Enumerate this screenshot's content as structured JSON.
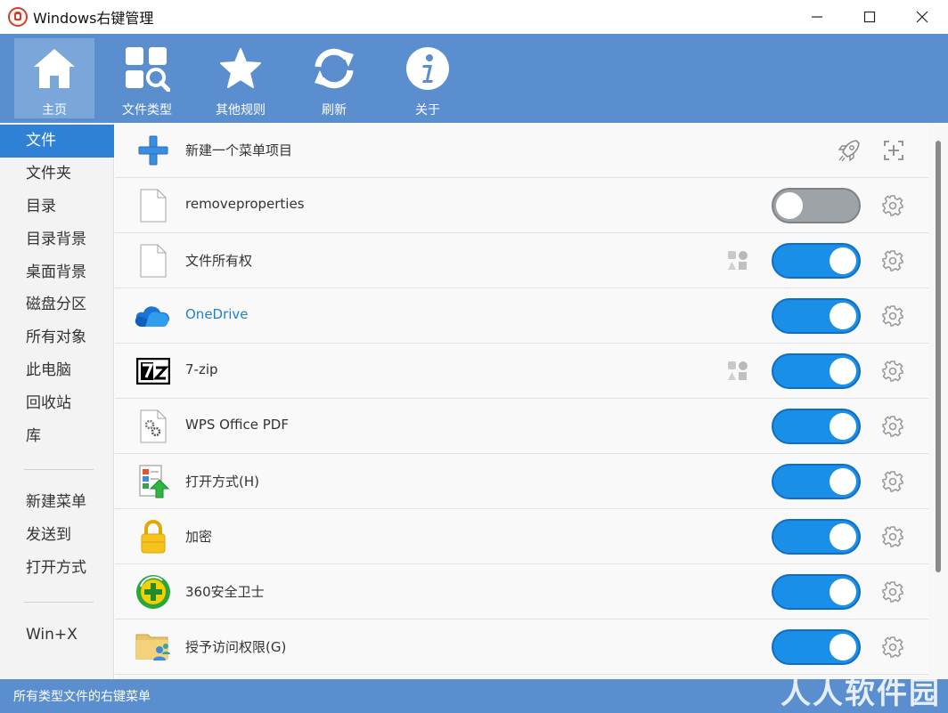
{
  "window": {
    "title": "Windows右键管理",
    "minimize_icon": "minimize-icon",
    "maximize_icon": "maximize-icon",
    "close_icon": "close-icon"
  },
  "toolbar": {
    "items": [
      {
        "label": "主页",
        "icon": "home-icon",
        "active": true
      },
      {
        "label": "文件类型",
        "icon": "file-type-search-icon",
        "active": false
      },
      {
        "label": "其他规则",
        "icon": "star-icon",
        "active": false
      },
      {
        "label": "刷新",
        "icon": "refresh-icon",
        "active": false
      },
      {
        "label": "关于",
        "icon": "info-icon",
        "active": false
      }
    ]
  },
  "sidebar": {
    "items": [
      {
        "label": "文件",
        "active": true
      },
      {
        "label": "文件夹"
      },
      {
        "label": "目录"
      },
      {
        "label": "目录背景"
      },
      {
        "label": "桌面背景"
      },
      {
        "label": "磁盘分区"
      },
      {
        "label": "所有对象"
      },
      {
        "label": "此电脑"
      },
      {
        "label": "回收站"
      },
      {
        "label": "库"
      },
      {
        "label": "新建菜单"
      },
      {
        "label": "发送到"
      },
      {
        "label": "打开方式"
      },
      {
        "label": "Win+X"
      }
    ]
  },
  "main": {
    "new_item": {
      "label": "新建一个菜单项目",
      "icon": "plus-icon"
    },
    "rows": [
      {
        "label": "removeproperties",
        "enabled": false,
        "icon": "blank-file-icon"
      },
      {
        "label": "文件所有权",
        "enabled": true,
        "icon": "blank-file-icon",
        "shapes": true
      },
      {
        "label": "OneDrive",
        "enabled": true,
        "icon": "onedrive-cloud-icon",
        "link": true
      },
      {
        "label": "7-zip",
        "enabled": true,
        "icon": "7zip-icon",
        "shapes": true
      },
      {
        "label": "WPS Office PDF",
        "enabled": true,
        "icon": "settings-file-icon"
      },
      {
        "label": "打开方式(H)",
        "enabled": true,
        "icon": "open-with-icon"
      },
      {
        "label": "加密",
        "enabled": true,
        "icon": "padlock-icon"
      },
      {
        "label": "360安全卫士",
        "enabled": true,
        "icon": "360-security-icon"
      },
      {
        "label": "授予访问权限(G)",
        "enabled": true,
        "icon": "share-folder-icon"
      }
    ]
  },
  "status": {
    "text": "所有类型文件的右键菜单",
    "watermark": "人人软件园"
  },
  "colors": {
    "accent": "#5a8ecf",
    "toggle_on": "#1a8fe8",
    "toggle_off": "#9ea3a8",
    "sidebar_active": "#2f81d6"
  }
}
